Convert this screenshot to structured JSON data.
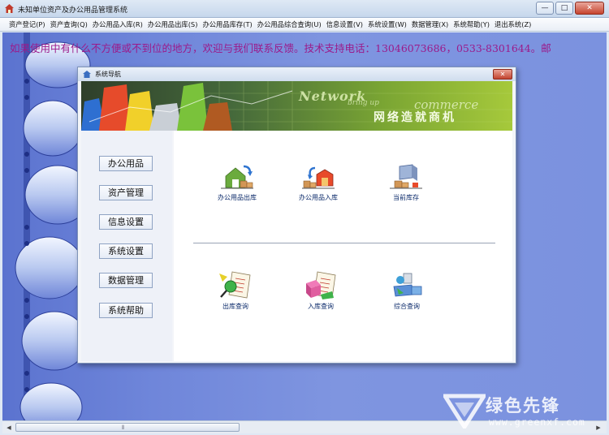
{
  "window": {
    "title": "未知单位资产及办公用品管理系统",
    "min_glyph": "—",
    "max_glyph": "□",
    "close_glyph": "✕"
  },
  "menu": [
    "资产登记(P)",
    "资产查询(Q)",
    "办公用品入库(R)",
    "办公用品出库(S)",
    "办公用品库存(T)",
    "办公用品综合查询(U)",
    "信息设置(V)",
    "系统设置(W)",
    "数据管理(X)",
    "系统帮助(Y)",
    "退出系统(Z)"
  ],
  "marquee": "如果使用中有什么不方便或不到位的地方，欢迎与我们联系反馈。技术支持电话：13046073686，0533-8301644。邮",
  "dialog": {
    "title": "系统导航",
    "close_glyph": "✕",
    "banner": {
      "word1": "Network",
      "word2": "bring up",
      "word3": "commerce",
      "cn": "网络造就商机"
    },
    "nav": [
      "办公用品",
      "资产管理",
      "信息设置",
      "系统设置",
      "数据管理",
      "系统帮助"
    ],
    "tools": {
      "office_out": "办公用品出库",
      "office_in": "办公用品入库",
      "stock": "当前库存",
      "out_query": "出库查询",
      "in_query": "入库查询",
      "combined_query": "综合查询"
    }
  },
  "scrollbar": {
    "left_glyph": "◀",
    "right_glyph": "▶",
    "grip_glyph": "⦀"
  },
  "watermark": {
    "cn": "绿色先锋",
    "url": "www.greenxf.com"
  },
  "colors": {
    "desktop": "#6f86da",
    "marquee": "#9b1a8a",
    "banner": "#7aa533"
  }
}
